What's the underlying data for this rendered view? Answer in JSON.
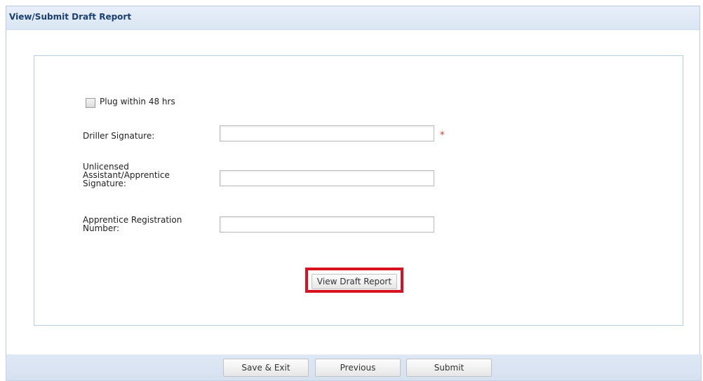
{
  "panel": {
    "title": "View/Submit Draft Report"
  },
  "form": {
    "plug_checkbox": {
      "label": "Plug within 48 hrs",
      "checked": false
    },
    "driller_signature": {
      "label": "Driller Signature:",
      "value": "",
      "required_marker": "*"
    },
    "assistant_signature": {
      "label_lines": [
        "Unlicensed",
        "Assistant/Apprentice",
        "Signature:"
      ],
      "value": ""
    },
    "apprentice_registration": {
      "label_lines": [
        "Apprentice Registration",
        "Number:"
      ],
      "value": ""
    },
    "view_draft_button": "View Draft Report",
    "highlight_color": "#d8131f"
  },
  "footer": {
    "save_exit": "Save & Exit",
    "previous": "Previous",
    "submit": "Submit"
  }
}
